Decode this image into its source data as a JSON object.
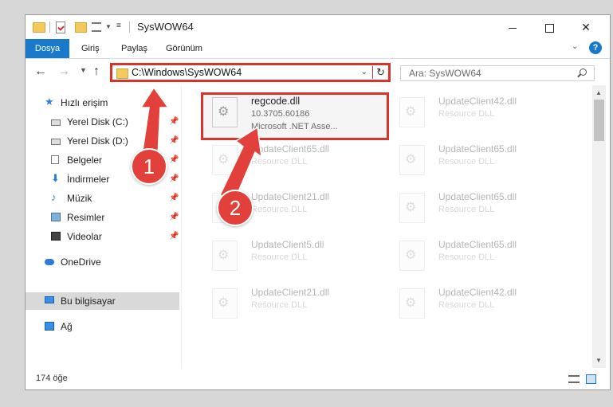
{
  "window": {
    "title": "SysWOW64",
    "controls": {
      "minimize": "minimize-button",
      "maximize": "maximize-button",
      "close": "✕"
    }
  },
  "ribbon": {
    "file_tab": "Dosya",
    "tabs": [
      "Giriş",
      "Paylaş",
      "Görünüm"
    ],
    "help": "?"
  },
  "nav": {
    "address": "C:\\Windows\\SysWOW64",
    "search_placeholder": "Ara: SysWOW64"
  },
  "sidebar": {
    "items": [
      {
        "label": "Hızlı erişim",
        "icon": "star-icon",
        "pinned": false
      },
      {
        "label": "Yerel Disk (C:)",
        "icon": "drive-icon",
        "pinned": true
      },
      {
        "label": "Yerel Disk (D:)",
        "icon": "drive-icon",
        "pinned": true
      },
      {
        "label": "Belgeler",
        "icon": "document-icon",
        "pinned": true
      },
      {
        "label": "İndirmeler",
        "icon": "download-icon",
        "pinned": true
      },
      {
        "label": "Müzik",
        "icon": "music-icon",
        "pinned": true
      },
      {
        "label": "Resimler",
        "icon": "pictures-icon",
        "pinned": true
      },
      {
        "label": "Videolar",
        "icon": "video-icon",
        "pinned": true
      },
      {
        "label": "OneDrive",
        "icon": "cloud-icon",
        "pinned": false
      },
      {
        "label": "Bu bilgisayar",
        "icon": "computer-icon",
        "pinned": false,
        "selected": true
      },
      {
        "label": "Ağ",
        "icon": "network-icon",
        "pinned": false
      }
    ]
  },
  "files": {
    "highlighted": {
      "name": "regcode.dll",
      "version": "10.3705.60186",
      "description": "Microsoft .NET Asse..."
    },
    "tiles": [
      {
        "name": "UpdateClient42.dll",
        "type": "Resource DLL"
      },
      {
        "name": "UpdateClient65.dll",
        "type": "Resource DLL"
      },
      {
        "name": "UpdateClient65.dll",
        "type": "Resource DLL"
      },
      {
        "name": "UpdateClient21.dll",
        "type": "Resource DLL"
      },
      {
        "name": "UpdateClient65.dll",
        "type": "Resource DLL"
      },
      {
        "name": "UpdateClient5.dll",
        "type": "Resource DLL"
      },
      {
        "name": "UpdateClient65.dll",
        "type": "Resource DLL"
      },
      {
        "name": "UpdateClient21.dll",
        "type": "Resource DLL"
      },
      {
        "name": "UpdateClient42.dll",
        "type": "Resource DLL"
      }
    ]
  },
  "status": {
    "item_count": "174 öğe"
  },
  "annotations": {
    "step1": "1",
    "step2": "2",
    "color": "#e2403a"
  }
}
